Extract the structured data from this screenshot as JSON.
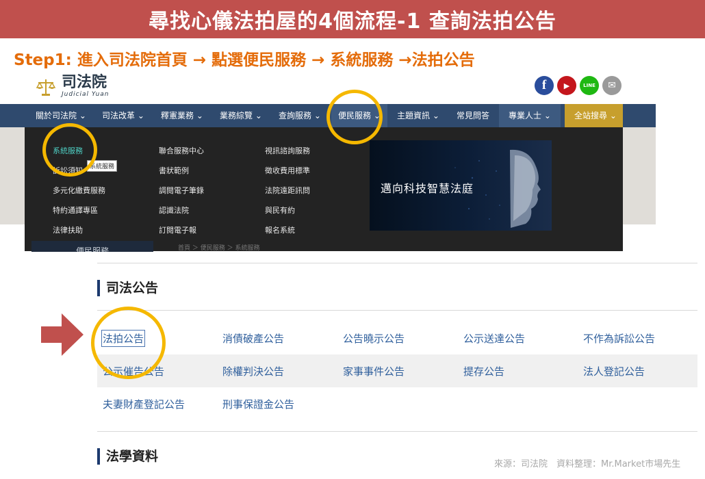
{
  "title": "尋找心儀法拍屋的4個流程-1 查詢法拍公告",
  "step": "Step1: 進入司法院首頁 → 點選便民服務 → 系統服務 →法拍公告",
  "logo": {
    "cn": "司法院",
    "en": "Judicial Yuan"
  },
  "social": {
    "facebook": "f",
    "youtube": "▶",
    "line": "LINE",
    "mail": "✉"
  },
  "nav": {
    "items": [
      "關於司法院 ⌄",
      "司法改革 ⌄",
      "釋憲業務 ⌄",
      "業務綜覽 ⌄",
      "查詢服務 ⌄",
      "便民服務 ⌄",
      "主題資訊 ⌄",
      "常見問答",
      "專業人士 ⌄"
    ],
    "search": "全站搜尋 ⌄"
  },
  "dropdown": {
    "col1": [
      "系統服務",
      "訴訟須知",
      "多元化繳費服務",
      "特約通譯專區",
      "法律扶助"
    ],
    "col2": [
      "聯合服務中心",
      "書狀範例",
      "調閱電子筆錄",
      "認識法院",
      "訂閱電子報"
    ],
    "col3": [
      "視訊諮詢服務",
      "徵收費用標準",
      "法院遠距訊問",
      "與民有約",
      "報名系統"
    ],
    "tooltip": "系統服務",
    "banner": "邁向科技智慧法庭"
  },
  "sidebar_title": "便民服務",
  "breadcrumb": "首頁 ＞ 便民服務 ＞ 系統服務",
  "sections": {
    "announcements": {
      "title": "司法公告",
      "rows": [
        [
          "法拍公告",
          "消債破產公告",
          "公告曉示公告",
          "公示送達公告",
          "不作為訴訟公告"
        ],
        [
          "公示催告公告",
          "除權判決公告",
          "家事事件公告",
          "提存公告",
          "法人登記公告"
        ],
        [
          "夫妻財產登記公告",
          "刑事保證金公告"
        ]
      ]
    },
    "legal": {
      "title": "法學資料"
    }
  },
  "source": "來源：司法院　資料整理：Mr.Market市場先生",
  "colors": {
    "title_bg": "#c0504d",
    "step_text": "#e46c0a",
    "nav_bg": "#2f4a6e",
    "highlight_circle": "#f5b800",
    "arrow": "#c0504d",
    "link": "#2f5f9c"
  }
}
